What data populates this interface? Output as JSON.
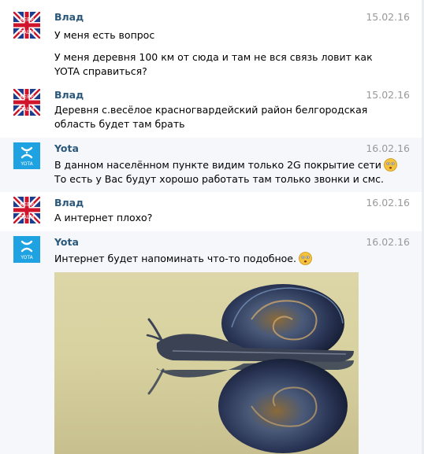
{
  "messages": [
    {
      "author": "Влад",
      "date": "15.02.16",
      "lines": [
        "У меня есть вопрос"
      ]
    },
    {
      "lines": [
        "У меня деревня 100 км от сюда и там не вся связь ловит как",
        "YOTA справиться?"
      ]
    },
    {
      "author": "Влад",
      "date": "15.02.16",
      "lines": [
        "Деревня с.весёлое красногвардейский район белгородская",
        "область будет там брать"
      ]
    },
    {
      "author": "Yota",
      "date": "16.02.16",
      "lines": [
        "В данном населённом пункте видим только 2G покрытие сети",
        "То есть у Вас будут хорошо работать там только звонки и смс."
      ]
    },
    {
      "author": "Влад",
      "date": "16.02.16",
      "lines": [
        "А интернет плохо?"
      ]
    },
    {
      "author": "Yota",
      "date": "16.02.16",
      "lines": [
        "Интернет будет напоминать что-то подобное."
      ]
    }
  ],
  "avatars": {
    "vlad": {
      "text_top": "KEEP",
      "text_mid": "CALM",
      "icon": "union-jack-keep-calm-avatar"
    },
    "yota": {
      "label": "YOTA",
      "brand_color": "#1fa2e1",
      "icon": "yota-logo-avatar"
    }
  },
  "colors": {
    "author": "#2b587a",
    "date": "#999999",
    "highlight": "#f5f7fa"
  }
}
